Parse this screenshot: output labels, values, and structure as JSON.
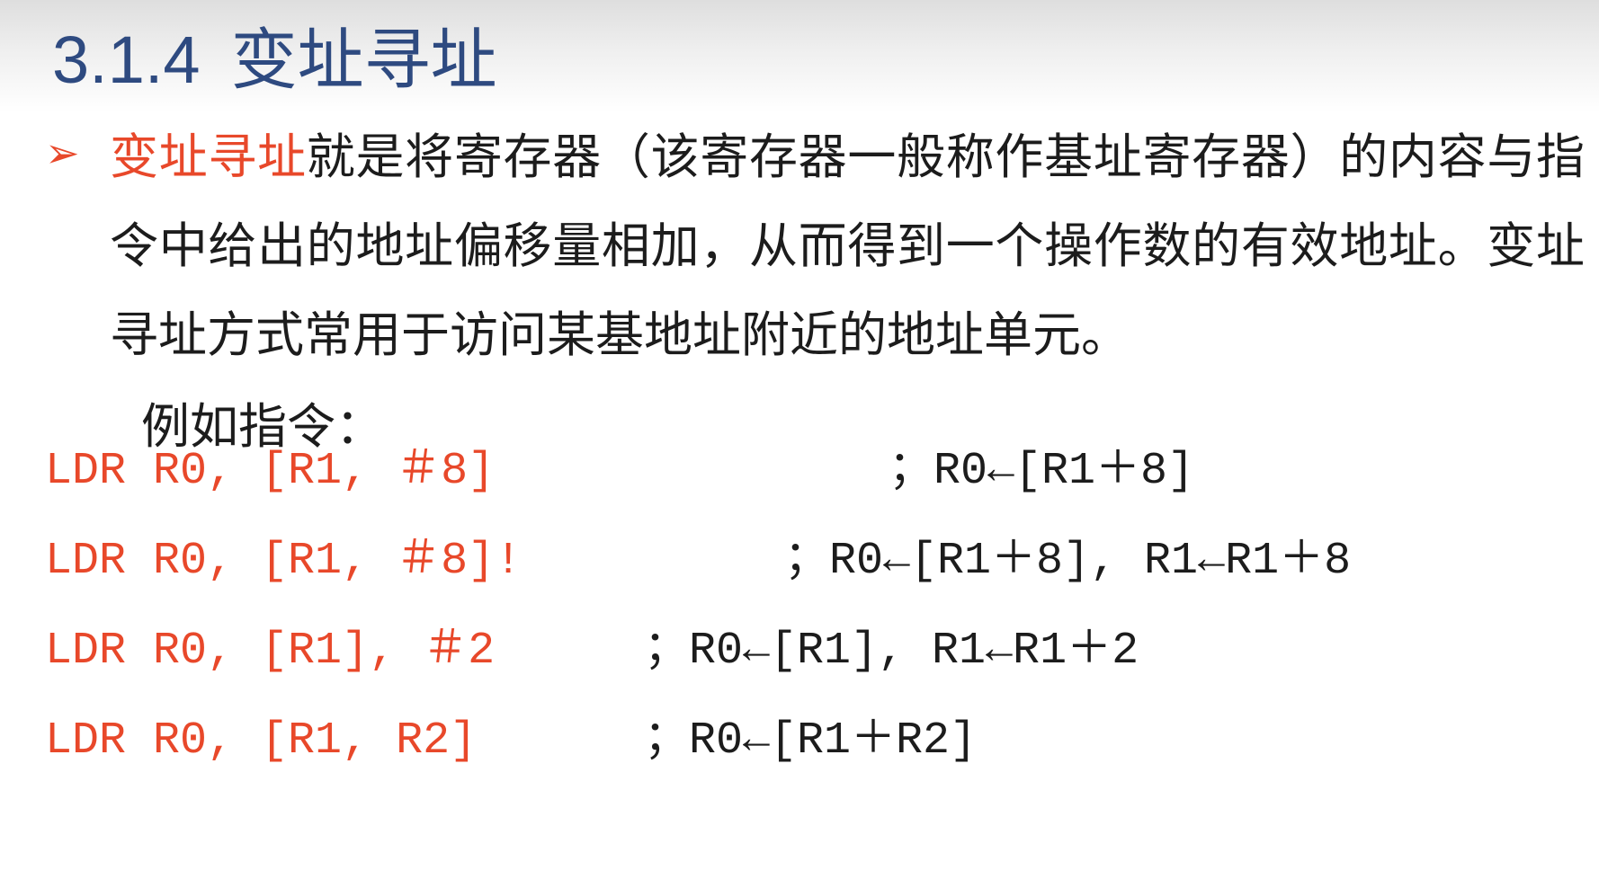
{
  "slide": {
    "title_number": "3.1.4",
    "title_text": "变址寻址"
  },
  "bullet": {
    "marker": "➢",
    "highlight": "变址寻址",
    "text": "就是将寄存器（该寄存器一般称作基址寄存器）的内容与指令中给出的地址偏移量相加，从而得到一个操作数的有效地址。变址寻址方式常用于访问某基地址附近的地址单元。"
  },
  "example_label": "例如指令：",
  "code": [
    {
      "instruction": "LDR R0, [R1, ＃8]",
      "comment": "；R0←[R1＋8]"
    },
    {
      "instruction": "LDR R0, [R1, ＃8]!",
      "comment": "；R0←[R1＋8], R1←R1＋8"
    },
    {
      "instruction": "LDR R0, [R1], ＃2",
      "comment": "；R0←[R1], R1←R1＋2"
    },
    {
      "instruction": "LDR R0, [R1, R2]",
      "comment": "；R0←[R1＋R2]"
    }
  ]
}
